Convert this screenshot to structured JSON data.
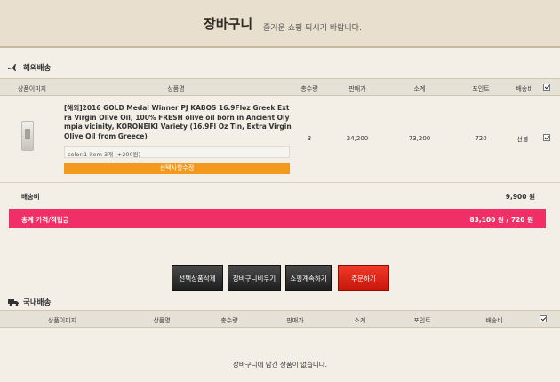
{
  "header": {
    "title": "장바구니",
    "subtitle": "즐거운 쇼핑 되시기 바랍니다."
  },
  "overseas": {
    "section_title": "해외배송",
    "columns": [
      "상품이미지",
      "상품명",
      "총수량",
      "판매가",
      "소계",
      "포인트",
      "배송비"
    ],
    "item": {
      "name": "[해외]2016 GOLD Medal Winner PJ KABOS 16.9Floz Greek Extra Virgin Olive Oil, 100% FRESH olive oil born in Ancient Olympia vicinity, KORONEIKI Variety (16.9Fl Oz Tin, Extra Virgin Olive Oil from Greece)",
      "option_text": "color:1 item 3개 (+200원)",
      "option_button": "선택사항수정",
      "quantity": "3",
      "price": "24,200",
      "subtotal": "73,200",
      "point": "720",
      "shipping": "선불"
    },
    "shipping_label": "배송비",
    "shipping_value": "9,900 원",
    "total_label": "총계 가격/적립금",
    "total_value": "83,100 원 / 720 원"
  },
  "buttons": {
    "delete_selected": "선택상품삭제",
    "empty_cart": "장바구니비우기",
    "continue_shopping": "쇼핑계속하기",
    "order": "주문하기"
  },
  "domestic": {
    "section_title": "국내배송",
    "columns": [
      "상품이미지",
      "상품명",
      "총수량",
      "판매가",
      "소계",
      "포인트",
      "배송비"
    ],
    "empty_message": "장바구니에 담긴 상품이 없습니다."
  },
  "colors": {
    "accent_pink": "#ef2f66",
    "option_orange": "#f39a1e",
    "order_red": "#e0281a"
  }
}
